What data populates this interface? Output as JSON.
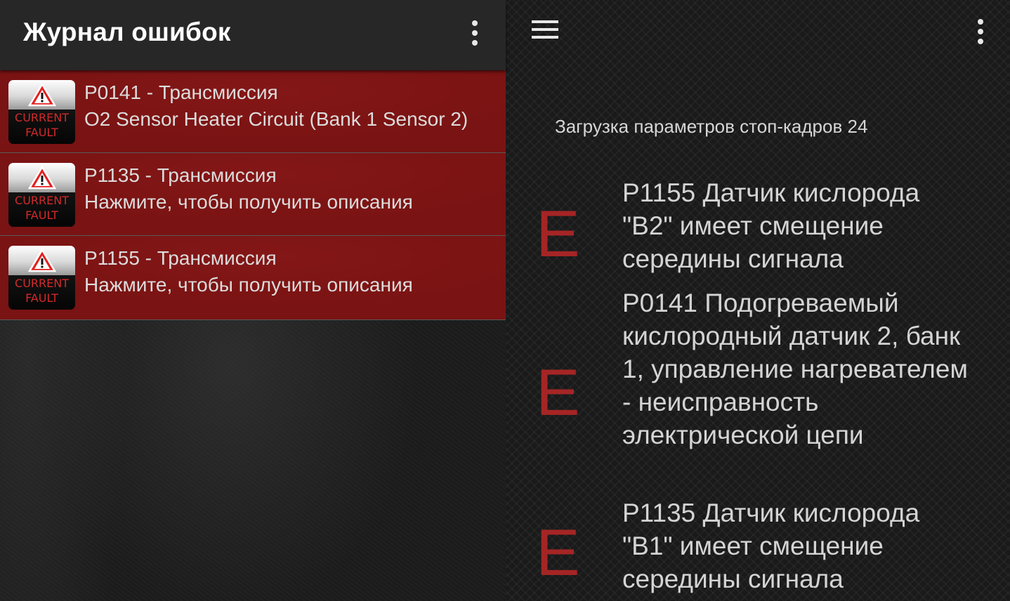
{
  "left_toolbar": {
    "title": "Журнал ошибок",
    "overflow_icon": "more-vert-icon"
  },
  "faults": [
    {
      "badge_line1": "CURRENT",
      "badge_line2": "FAULT",
      "badge_icon": "warning-triangle-icon",
      "code": "P0141 - Трансмиссия",
      "description": "O2 Sensor Heater Circuit (Bank 1 Sensor 2)"
    },
    {
      "badge_line1": "CURRENT",
      "badge_line2": "FAULT",
      "badge_icon": "warning-triangle-icon",
      "code": "P1135 - Трансмиссия",
      "description": "Нажмите, чтобы получить описания"
    },
    {
      "badge_line1": "CURRENT",
      "badge_line2": "FAULT",
      "badge_icon": "warning-triangle-icon",
      "code": "P1155 - Трансмиссия",
      "description": "Нажмите, чтобы получить описания"
    }
  ],
  "right_toolbar": {
    "menu_icon": "hamburger-menu-icon",
    "overflow_icon": "more-vert-icon"
  },
  "freeze_frame": {
    "label": "Загрузка параметров стоп-кадров 24"
  },
  "dtc_entries": [
    {
      "letter": "E",
      "text": "P1155 Датчик кислорода \"B2\" имеет смещение середины сигнала"
    },
    {
      "letter": "E",
      "text": "P0141 Подогреваемый кислородный датчик 2, банк 1, управление нагревателем - неисправность электрической цепи"
    },
    {
      "letter": "E",
      "text": "P1135 Датчик кислорода \"B1\" имеет смещение середины сигнала"
    }
  ],
  "colors": {
    "fault_row_bg": "#7a1313",
    "badge_text": "#d12a2a",
    "dtc_letter": "#a52525",
    "toolbar_bg": "#272727"
  }
}
